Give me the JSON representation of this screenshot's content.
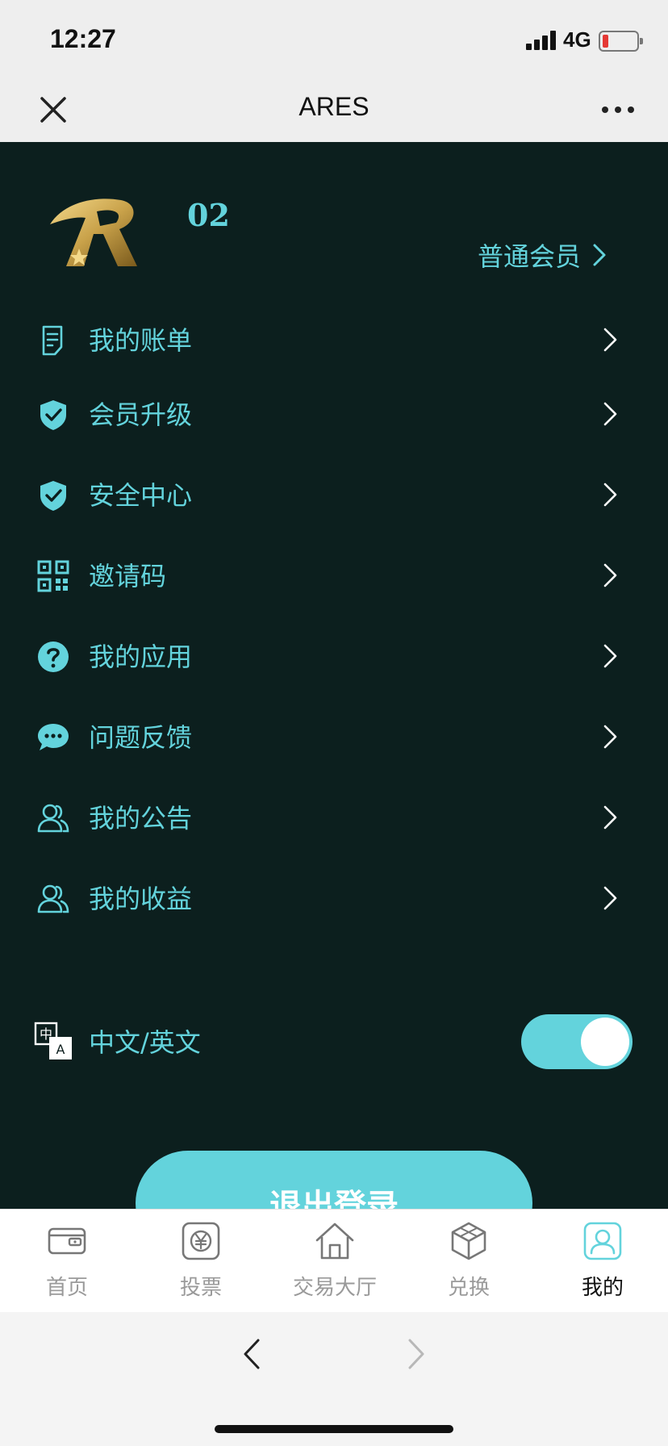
{
  "status_bar": {
    "time": "12:27",
    "network": "4G"
  },
  "nav": {
    "title": "ARES"
  },
  "profile": {
    "uid": "02",
    "member_level": "普通会员"
  },
  "menu": [
    {
      "label": "我的账单",
      "icon": "bill-icon"
    },
    {
      "label": "会员升级",
      "icon": "shield-check-icon"
    },
    {
      "label": "安全中心",
      "icon": "shield-check-icon"
    },
    {
      "label": "邀请码",
      "icon": "qr-code-icon"
    },
    {
      "label": "我的应用",
      "icon": "question-icon"
    },
    {
      "label": "问题反馈",
      "icon": "chat-bubble-icon"
    },
    {
      "label": "我的公告",
      "icon": "users-icon"
    },
    {
      "label": "我的收益",
      "icon": "users-icon"
    },
    {
      "label": "中文/英文",
      "icon": "language-icon",
      "toggle_on": true
    }
  ],
  "logout_label": "退出登录",
  "tabs": [
    {
      "label": "首页",
      "icon": "wallet-icon"
    },
    {
      "label": "投票",
      "icon": "yen-icon"
    },
    {
      "label": "交易大厅",
      "icon": "home-icon"
    },
    {
      "label": "兑换",
      "icon": "cube-icon"
    },
    {
      "label": "我的",
      "icon": "user-icon",
      "active": true
    }
  ],
  "colors": {
    "accent": "#63d3dc",
    "background": "#0c1f1e",
    "logo_gold": "#c9a24a"
  }
}
